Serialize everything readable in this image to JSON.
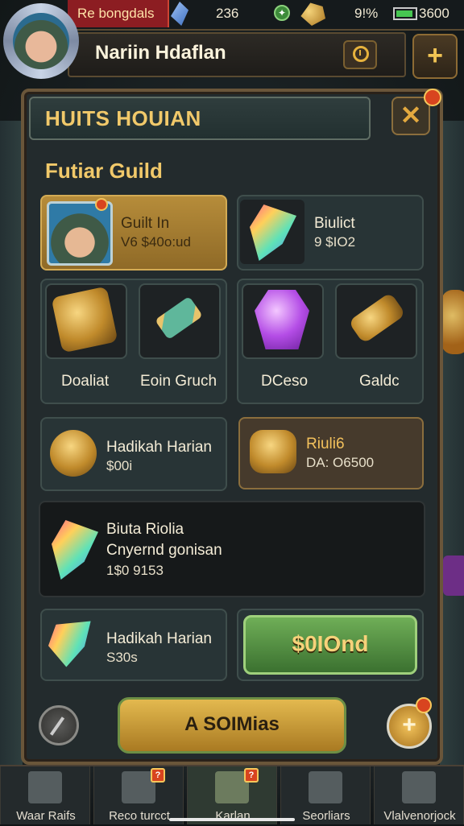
{
  "status_bar": {
    "tag": "Re bongdals",
    "count": "236",
    "battery_text": "9!%",
    "battery_level": 0.9,
    "currency": "3600"
  },
  "header": {
    "player_name": "Nariin Hdaflan",
    "plus_label": "+"
  },
  "panel": {
    "title": "HUITS HOUIAN",
    "close_label": "✕",
    "section_title": "Futiar Guild"
  },
  "cards": {
    "guild": {
      "line1": "Guilt In",
      "line2": "V6 $40o:ud"
    },
    "crystal": {
      "line1": "Biulict",
      "line2": "9 $IO2"
    },
    "items_left": [
      "Doaliat",
      "Eoin Gruch"
    ],
    "items_right": [
      "DCeso",
      "Galdc"
    ],
    "reward_left": {
      "line1": "Hadikah Harian",
      "line2": "$00i"
    },
    "reward_right": {
      "line1": "Riuli6",
      "line2": "DA: O6500"
    },
    "feature": {
      "line1": "Biuta Riolia",
      "line2": "Cnyernd gonisan",
      "line3": "1$0 9153"
    },
    "daily": {
      "line1": "Hadikah Harian",
      "line2": "S30s"
    }
  },
  "buttons": {
    "green": "$0IOnd",
    "gold": "A SOIMias",
    "round_right": "+"
  },
  "nav": [
    {
      "label": "Waar Raifs",
      "icon": "castle-icon"
    },
    {
      "label": "Reco turcct",
      "icon": "tent-icon",
      "badge": "?"
    },
    {
      "label": "Karlan",
      "icon": "scroll-icon",
      "badge": "?"
    },
    {
      "label": "Seorliars",
      "icon": "cloak-icon"
    },
    {
      "label": "Vlalvenorjock",
      "icon": "helmet-icon"
    }
  ],
  "colors": {
    "accent_gold": "#f1c96a",
    "panel_bg": "#232b2d",
    "alert_red": "#d8441f",
    "button_green": "#6fae57"
  }
}
